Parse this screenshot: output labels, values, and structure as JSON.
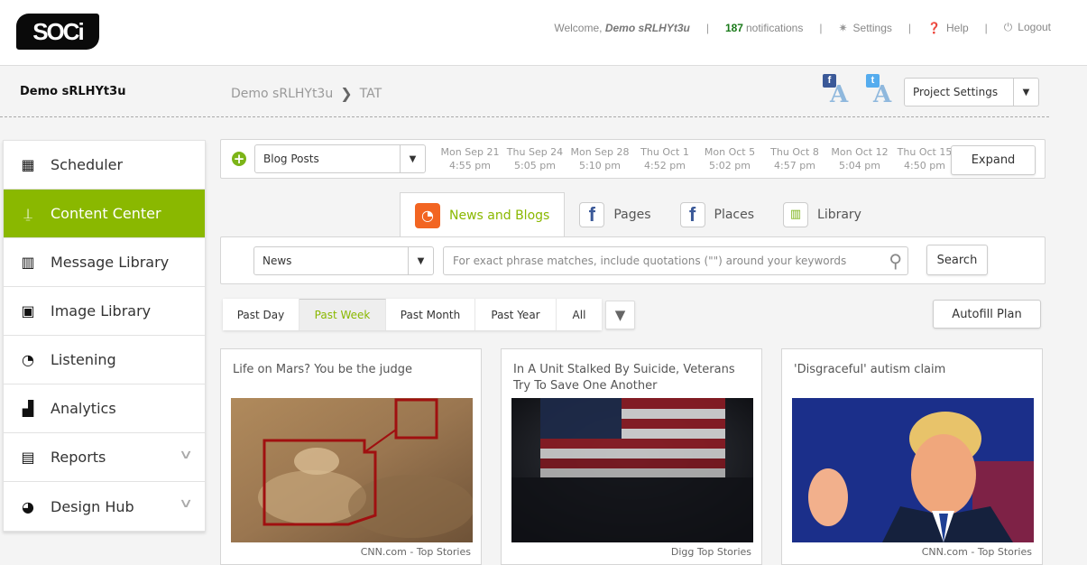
{
  "app": {
    "logo_text": "SOCi"
  },
  "topnav": {
    "welcome_prefix": "Welcome,",
    "user_name": "Demo sRLHYt3u",
    "notification_count": "187",
    "notification_label": "notifications",
    "settings": "Settings",
    "help": "Help",
    "logout": "Logout",
    "separator": "|"
  },
  "subheader": {
    "account_name": "Demo sRLHYt3u",
    "breadcrumb": [
      "Demo sRLHYt3u",
      "TAT"
    ],
    "facebook_badge": "f",
    "twitter_badge": "t",
    "avatar_letter": "A",
    "project_settings": "Project Settings"
  },
  "sidebar": {
    "items": [
      {
        "label": "Scheduler",
        "icon": "calendar-icon",
        "active": false
      },
      {
        "label": "Content Center",
        "icon": "shovel-icon",
        "active": true
      },
      {
        "label": "Message Library",
        "icon": "binders-icon",
        "active": false
      },
      {
        "label": "Image Library",
        "icon": "images-icon",
        "active": false
      },
      {
        "label": "Listening",
        "icon": "rss-icon",
        "active": false
      },
      {
        "label": "Analytics",
        "icon": "bar-chart-icon",
        "active": false
      },
      {
        "label": "Reports",
        "icon": "document-icon",
        "active": false,
        "expandable": true
      },
      {
        "label": "Design Hub",
        "icon": "palette-icon",
        "active": false,
        "expandable": true
      }
    ]
  },
  "plan_bar": {
    "content_type": "Blog Posts",
    "dates": [
      {
        "day": "Mon Sep 21",
        "time": "4:55 pm"
      },
      {
        "day": "Thu Sep 24",
        "time": "5:05 pm"
      },
      {
        "day": "Mon Sep 28",
        "time": "5:10 pm"
      },
      {
        "day": "Thu Oct 1",
        "time": "4:52 pm"
      },
      {
        "day": "Mon Oct 5",
        "time": "5:02 pm"
      },
      {
        "day": "Thu Oct 8",
        "time": "4:57 pm"
      },
      {
        "day": "Mon Oct 12",
        "time": "5:04 pm"
      },
      {
        "day": "Thu Oct 15",
        "time": "4:50 pm"
      }
    ],
    "expand_label": "Expand"
  },
  "tabs": [
    {
      "label": "News and Blogs",
      "icon": "rss-icon",
      "active": true
    },
    {
      "label": "Pages",
      "icon": "facebook-icon",
      "active": false
    },
    {
      "label": "Places",
      "icon": "facebook-icon",
      "active": false
    },
    {
      "label": "Library",
      "icon": "library-icon",
      "active": false
    }
  ],
  "search": {
    "source": "News",
    "placeholder": "For exact phrase matches, include quotations (\"\") around your keywords",
    "button": "Search"
  },
  "time_filters": {
    "options": [
      "Past Day",
      "Past Week",
      "Past Month",
      "Past Year",
      "All"
    ],
    "selected": "Past Week",
    "autofill_label": "Autofill Plan"
  },
  "colors": {
    "accent": "#8ab800",
    "rss": "#f26522",
    "facebook": "#3b5998",
    "notification": "#1a7a1a"
  },
  "articles": [
    {
      "title": "Life on Mars? You be the judge",
      "source": "CNN.com - Top Stories"
    },
    {
      "title": "In A Unit Stalked By Suicide, Veterans Try To Save One Another",
      "source": "Digg Top Stories"
    },
    {
      "title": "'Disgraceful' autism claim",
      "source": "CNN.com - Top Stories"
    }
  ]
}
